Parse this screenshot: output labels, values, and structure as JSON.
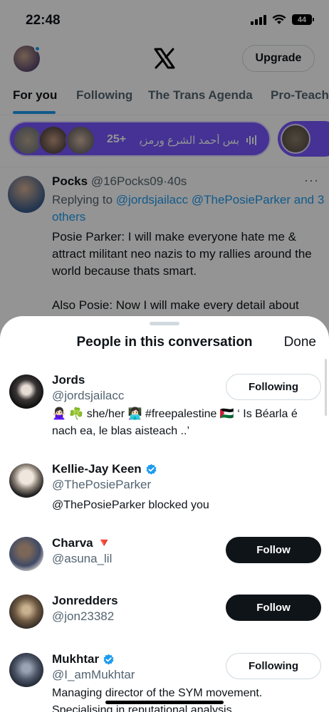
{
  "status": {
    "time": "22:48",
    "battery": "44"
  },
  "header": {
    "upgrade_label": "Upgrade"
  },
  "tabs": [
    {
      "label": "For you"
    },
    {
      "label": "Following"
    },
    {
      "label": "The Trans Agenda"
    },
    {
      "label": "Pro-Teach"
    }
  ],
  "spaces": {
    "count": "25+",
    "title": "بس أحمد الشرع ورمزيات"
  },
  "tweet": {
    "name": "Pocks",
    "handle": "@16Pocks09",
    "time": "40s",
    "replying_prefix": "Replying to",
    "replying_to": "@jordsjailacc @ThePosieParker and 3 others",
    "body_1": "Posie Parker: I will make everyone hate me & attract militant neo nazis to my rallies around the world because thats smart.",
    "body_2": "Also Posie: Now I will make every detail about"
  },
  "sheet": {
    "title": "People in this conversation",
    "done_label": "Done",
    "people": [
      {
        "name": "Jords",
        "handle": "@jordsjailacc",
        "bio": "🙅🏻‍♀️ ☘️ she/her 👩🏻‍💻 #freepalestine 🇵🇸 ‘ Is Béarla é nach ea, le blas aisteach ..’",
        "button": "Following"
      },
      {
        "name": "Kellie-Jay Keen",
        "handle": "@ThePosieParker",
        "bio": "@ThePosieParker blocked you",
        "verified": true
      },
      {
        "name": "Charva",
        "emoji": "🔻",
        "handle": "@asuna_lil",
        "button": "Follow"
      },
      {
        "name": "Jonredders",
        "handle": "@jon23382",
        "button": "Follow"
      },
      {
        "name": "Mukhtar",
        "handle": "@I_amMukhtar",
        "bio": "Managing director of the SYM movement. Specialising in reputational analysis.",
        "verified": true,
        "button": "Following"
      }
    ]
  },
  "colors": {
    "accent": "#1d9bf0",
    "spaces": "#7856ff",
    "text": "#0f1419",
    "muted": "#536471"
  }
}
